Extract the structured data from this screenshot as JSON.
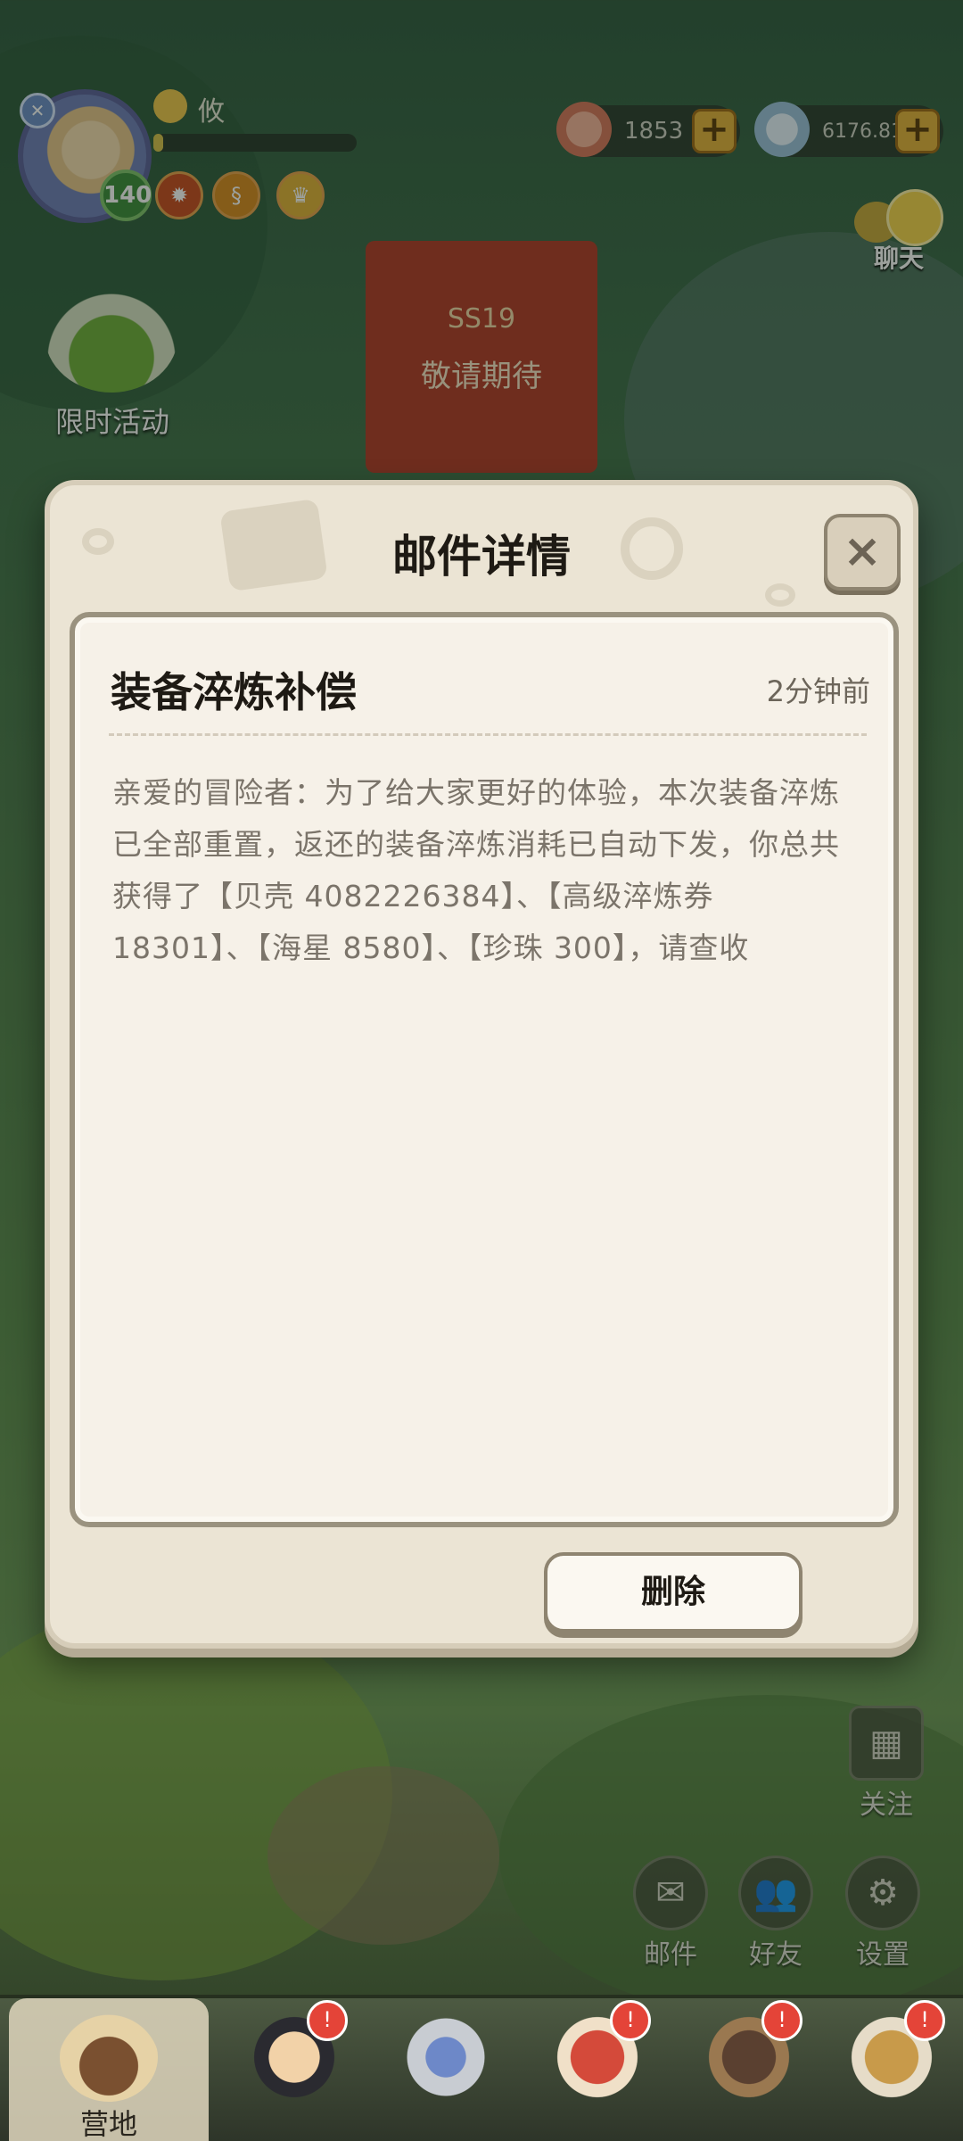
{
  "top_bar": {
    "player_name": "攸",
    "level": "140",
    "xp_progress": 0.05,
    "currencies": [
      {
        "icon": "shell-icon",
        "value": "1853"
      },
      {
        "icon": "pearl-pile-icon",
        "value": "6176.81M"
      }
    ]
  },
  "hud": {
    "chat_label": "聊天",
    "event_label": "限时活动",
    "banner_season": "SS19",
    "banner_text": "敬请期待"
  },
  "modal": {
    "title": "邮件详情",
    "close_icon": "close-icon",
    "mail": {
      "subject": "装备淬炼补偿",
      "time": "2分钟前",
      "body": "亲爱的冒险者：为了给大家更好的体验，本次装备淬炼已全部重置，返还的装备淬炼消耗已自动下发，你总共获得了【贝壳 4082226384】、【高级淬炼券 18301】、【海星 8580】、【珍珠 300】，请查收"
    },
    "delete_label": "删除"
  },
  "side_buttons": {
    "follow": "关注",
    "mail": "邮件",
    "friends": "好友",
    "settings": "设置"
  },
  "bottom_nav": {
    "items": [
      {
        "label": "营地",
        "active": true
      },
      {
        "label": "",
        "active": false
      },
      {
        "label": "",
        "active": false
      },
      {
        "label": "",
        "active": false
      },
      {
        "label": "",
        "active": false
      },
      {
        "label": "",
        "active": false
      }
    ]
  },
  "colors": {
    "modal_bg": "#ebe4d4",
    "content_bg": "#f6f1e8",
    "accent_gold": "#e6b23a",
    "badge_red": "#e44438"
  }
}
